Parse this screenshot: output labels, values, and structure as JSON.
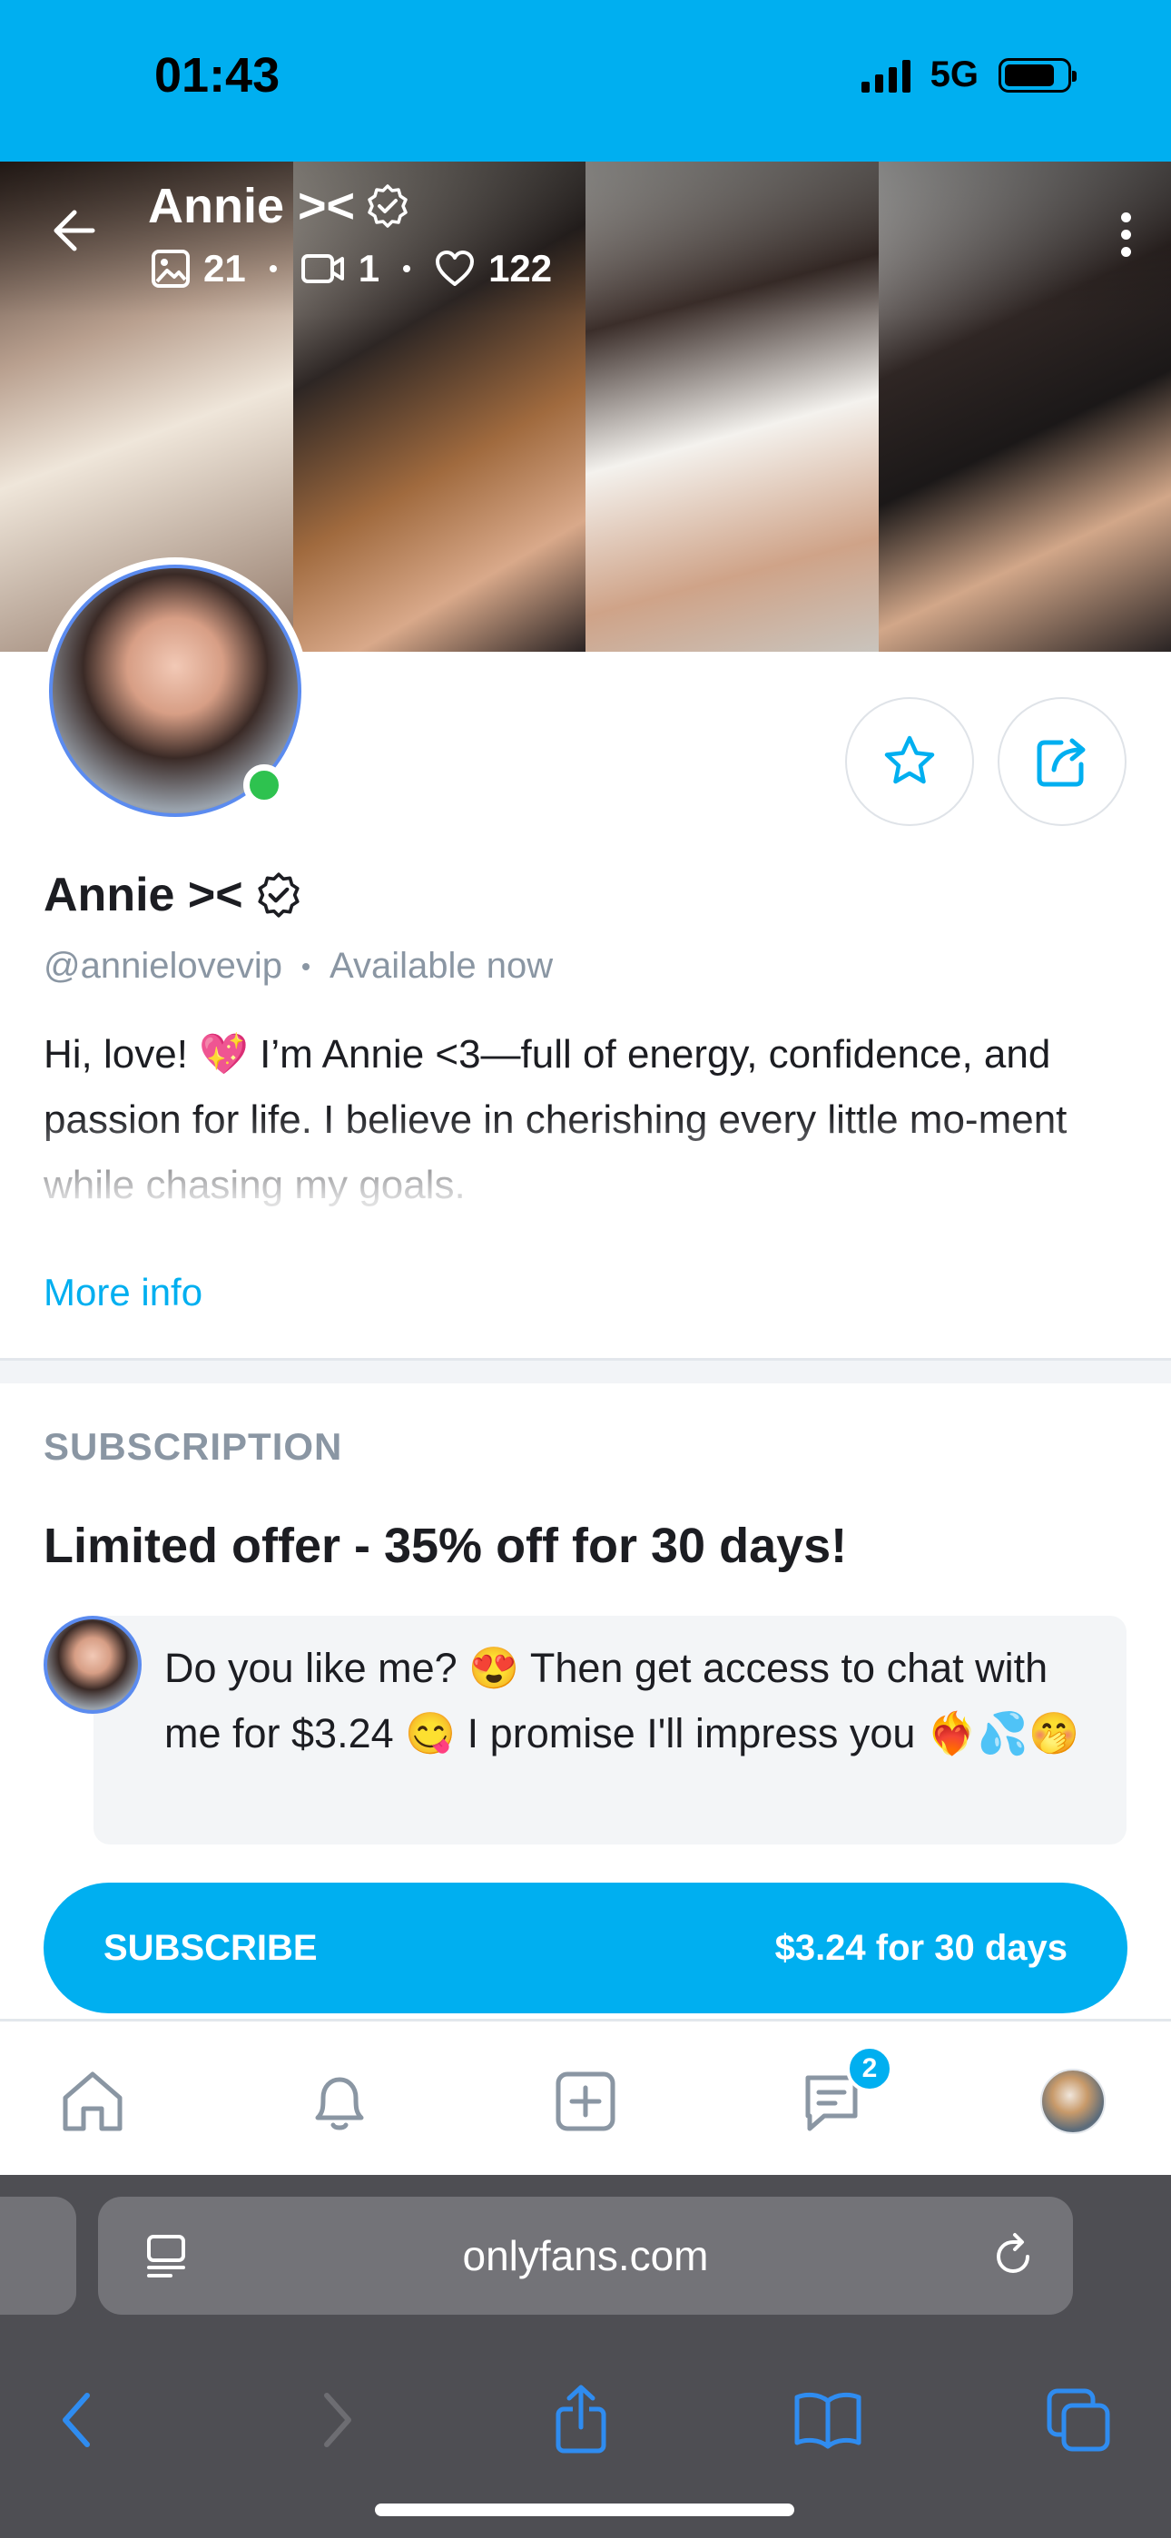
{
  "status_bar": {
    "time": "01:43",
    "network": "5G",
    "battery_level": 0.85
  },
  "cover": {
    "name": "Annie ><",
    "stats": [
      {
        "icon": "image-icon",
        "count": "21"
      },
      {
        "icon": "video-icon",
        "count": "1"
      },
      {
        "icon": "heart-icon",
        "count": "122"
      }
    ]
  },
  "profile": {
    "name": "Annie ><",
    "handle": "@annielovevip",
    "availability": "Available now",
    "bio": "Hi, love! 💖 I’m Annie <3—full of energy, confidence, and passion for life. I believe in cherishing every little mo-ment while chasing my goals.",
    "more_info_label": "More info"
  },
  "subscription": {
    "section_label": "SUBSCRIPTION",
    "offer_title": "Limited offer - 35% off for 30 days!",
    "message": "Do you like me? 😍 Then get access to chat with me for $3.24 😋 I promise I'll impress you ❤️‍🔥💦🤭",
    "button_label": "SUBSCRIBE",
    "button_price": "$3.24 for 30 days"
  },
  "bottom_nav": {
    "items": [
      "home-icon",
      "bell-icon",
      "add-post-icon",
      "messages-icon",
      "user-avatar"
    ],
    "messages_badge": "2"
  },
  "browser": {
    "url": "onlyfans.com"
  },
  "colors": {
    "accent": "#00aff0",
    "online": "#2ec24f",
    "muted": "#8a96a3"
  }
}
